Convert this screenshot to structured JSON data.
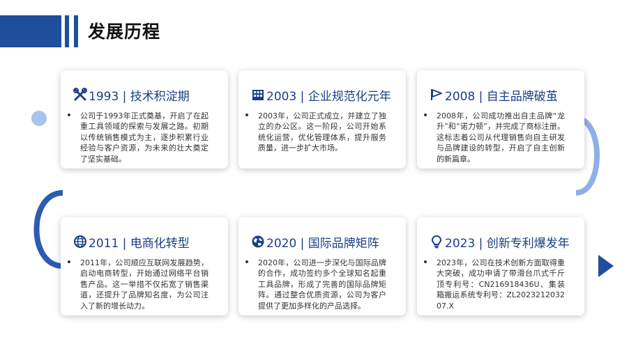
{
  "header": {
    "title": "发展历程"
  },
  "milestones": [
    {
      "icon": "tools-icon",
      "title": "1993 | 技术积淀期",
      "text": "公司于1993年正式奠基，开启了在起重工具领域的探索与发展之路。初期以传统销售模式为主，逐步积累行业经验与客户资源，为未来的壮大奠定了坚实基础。"
    },
    {
      "icon": "building-icon",
      "title": "2003 | 企业规范化元年",
      "text": "2003年，公司正式成立，并建立了独立的办公区。这一阶段，公司开始系统化运营，优化管理体系，提升服务质量，进一步扩大市场。"
    },
    {
      "icon": "flag-icon",
      "title": "2008 | 自主品牌破茧",
      "text": "2008年，公司成功推出自主品牌“龙升”和“诺力顿”，并完成了商标注册。这标志着公司从代理销售向自主研发与品牌建设的转型，开启了自主创新的新篇章。"
    },
    {
      "icon": "globe-icon",
      "title": "2011 | 电商化转型",
      "text": "2011年，公司顺应互联网发展趋势，启动电商转型，开始通过网络平台销售产品。这一举措不仅拓宽了销售渠道，还提升了品牌知名度，为公司注入了新的增长动力。"
    },
    {
      "icon": "earth-icon",
      "title": "2020 | 国际品牌矩阵",
      "text": "2020年，公司进一步深化与国际品牌的合作，成功签约多个全球知名起重工具品牌，形成了完善的国际品牌矩阵。通过整合优质资源，公司为客户提供了更加多样化的产品选择。"
    },
    {
      "icon": "lightbulb-icon",
      "title": "2023 | 创新专利爆发年",
      "text": "2023年，公司在技术创新方面取得重大突破，成功申请了带滑台爪式千斤顶专利号：CN216918436U、集装箱搬运系统专利号：ZL202321203207.X"
    }
  ],
  "colors": {
    "accent": "#1f4e9b",
    "title_text": "#1a3f86",
    "timeline_light": "#c9daf5",
    "timeline_dark": "#1f4e9b"
  }
}
